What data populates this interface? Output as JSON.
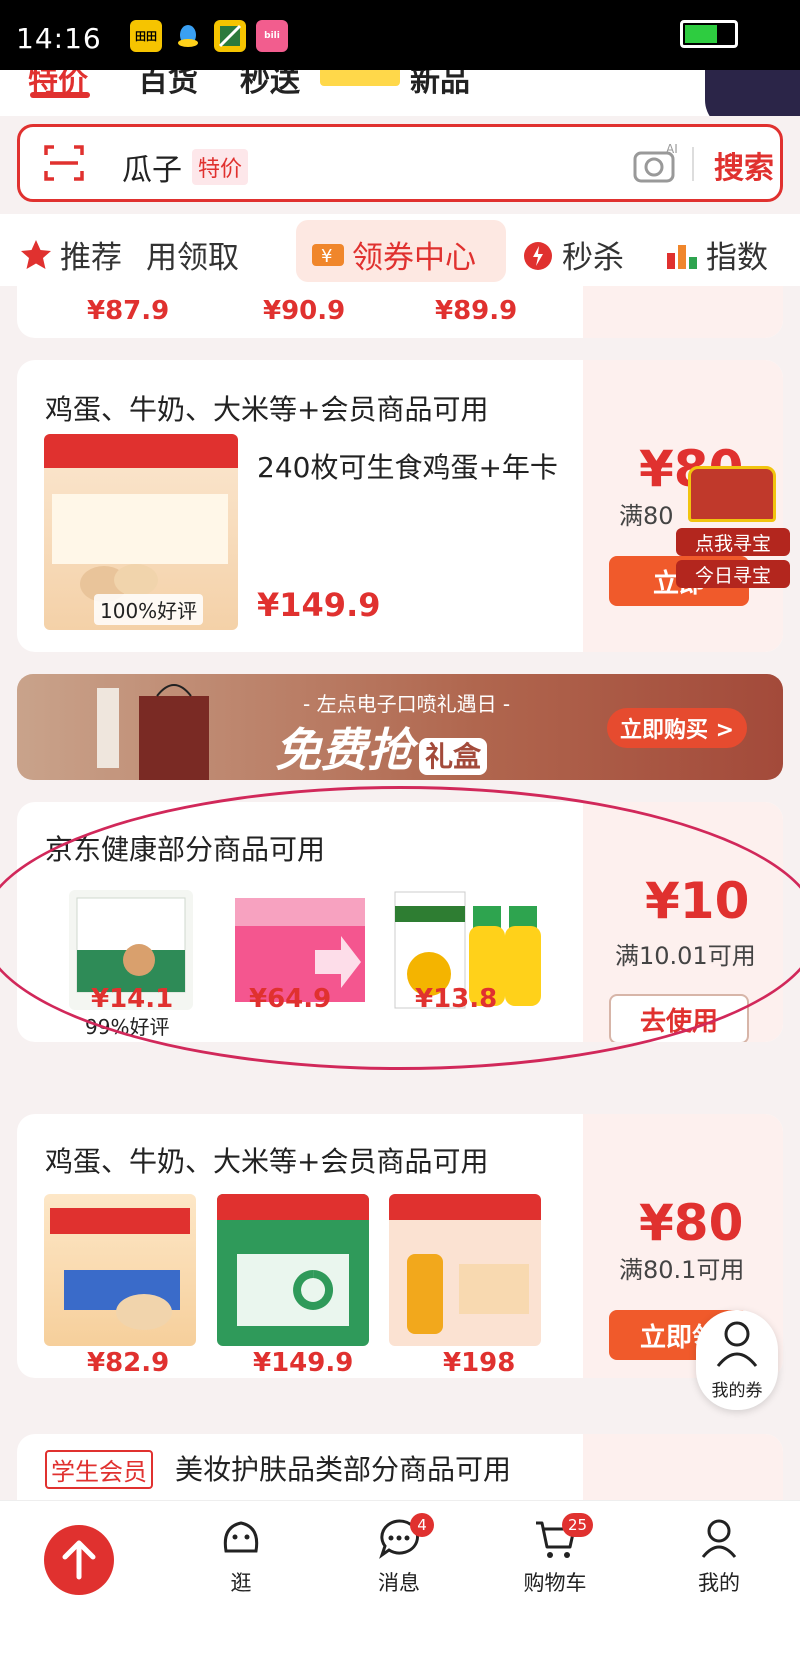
{
  "status_bar": {
    "time": "14:16",
    "app_icons": [
      "田田",
      "QQ",
      "app",
      "bilibili"
    ]
  },
  "top_tabs": [
    "特价",
    "百货",
    "秒送",
    "新品"
  ],
  "search": {
    "keyword": "瓜子",
    "tag": "特价",
    "button": "搜索"
  },
  "categories": [
    "推荐",
    "用领取",
    "领券中心",
    "秒杀",
    "指数"
  ],
  "card0": {
    "prices": [
      "¥87.9",
      "¥90.9",
      "¥89.9"
    ]
  },
  "card1": {
    "title": "鸡蛋、牛奶、大米等+会员商品可用",
    "product_title": "240枚可生食鸡蛋+年卡",
    "price": "¥149.9",
    "rating": "100%好评",
    "amount": "¥80",
    "condition": "满80",
    "button": "立即"
  },
  "treasure": {
    "line1": "点我寻宝",
    "line2": "今日寻宝"
  },
  "banner": {
    "subtitle": "- 左点电子口喷礼遇日 -",
    "main": "免费抢",
    "gift": "礼盒",
    "cta": "立即购买 >"
  },
  "card2": {
    "title": "京东健康部分商品可用",
    "rating": "99%好评",
    "prices": [
      "¥14.1",
      "¥64.9",
      "¥13.8"
    ],
    "amount": "¥10",
    "condition": "满10.01可用",
    "button": "去使用"
  },
  "card3": {
    "title": "鸡蛋、牛奶、大米等+会员商品可用",
    "prices": [
      "¥82.9",
      "¥149.9",
      "¥198"
    ],
    "amount": "¥80",
    "condition": "满80.1可用",
    "button": "立即领"
  },
  "card4": {
    "tag": "学生会员",
    "title": "美妆护肤品类部分商品可用"
  },
  "my_coupon": "我的券",
  "bottom_nav": {
    "tabs": [
      "逛",
      "消息",
      "购物车",
      "我的"
    ],
    "message_badge": "4",
    "cart_badge": "25"
  },
  "colors": {
    "accent": "#e0312f",
    "button_orange": "#f05a2b",
    "annotation": "#d1285a"
  }
}
